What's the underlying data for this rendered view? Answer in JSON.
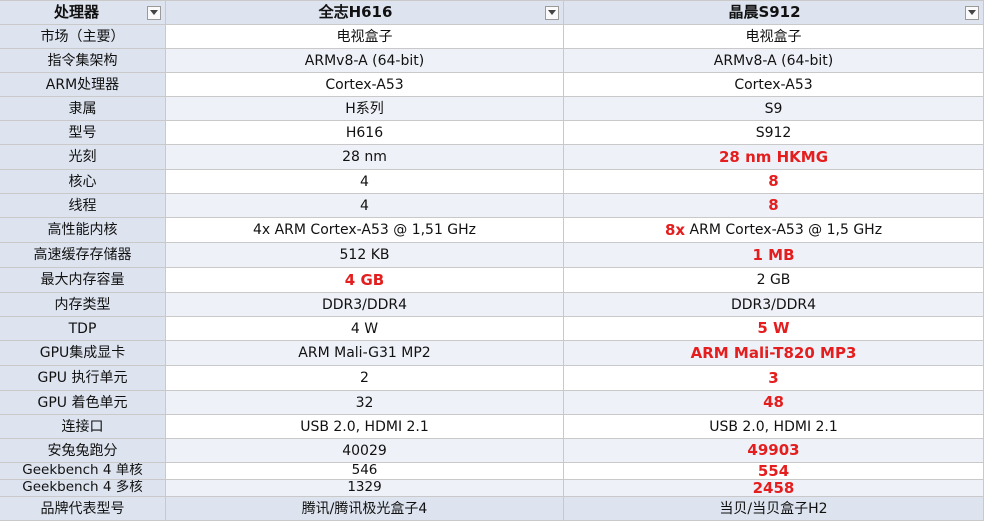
{
  "table": {
    "headers": [
      "处理器",
      "全志H616",
      "晶晨S912"
    ],
    "rows": [
      {
        "label": "市场（主要）",
        "a": "电视盒子",
        "b": "电视盒子"
      },
      {
        "label": "指令集架构",
        "a": "ARMv8-A (64-bit)",
        "b": "ARMv8-A (64-bit)"
      },
      {
        "label": "ARM处理器",
        "a": "Cortex-A53",
        "b": "Cortex-A53"
      },
      {
        "label": "隶属",
        "a": "H系列",
        "b": "S9"
      },
      {
        "label": "型号",
        "a": "H616",
        "b": "S912"
      },
      {
        "label": "光刻",
        "a": "28 nm",
        "b": "28 nm HKMG",
        "win": "b"
      },
      {
        "label": "核心",
        "a": "4",
        "b": "8",
        "win": "b"
      },
      {
        "label": "线程",
        "a": "4",
        "b": "8",
        "win": "b"
      },
      {
        "label": "高性能内核",
        "a": "4x ARM Cortex-A53 @ 1,51 GHz",
        "b_bold": "8x",
        "b_rest": " ARM Cortex-A53 @ 1,5 GHz"
      },
      {
        "label": "高速缓存存储器",
        "a": "512 KB",
        "b": "1 MB",
        "win": "b"
      },
      {
        "label": "最大内存容量",
        "a": "4 GB",
        "b": "2 GB",
        "win": "a"
      },
      {
        "label": "内存类型",
        "a": "DDR3/DDR4",
        "b": "DDR3/DDR4"
      },
      {
        "label": "TDP",
        "a": "4 W",
        "b": "5 W",
        "win": "b"
      },
      {
        "label": "GPU集成显卡",
        "a": "ARM Mali-G31 MP2",
        "b": "ARM Mali-T820 MP3",
        "win": "b"
      },
      {
        "label": "GPU 执行单元",
        "a": "2",
        "b": "3",
        "win": "b"
      },
      {
        "label": "GPU 着色单元",
        "a": "32",
        "b": "48",
        "win": "b"
      },
      {
        "label": "连接口",
        "a": "USB 2.0, HDMI 2.1",
        "b": "USB 2.0, HDMI 2.1"
      },
      {
        "label": "安兔兔跑分",
        "a": "40029",
        "b": "49903",
        "win": "b"
      },
      {
        "label": "Geekbench 4 单核",
        "a": "546",
        "b": "554",
        "win": "b"
      },
      {
        "label": "Geekbench 4 多核",
        "a": "1329",
        "b": "2458",
        "win": "b"
      },
      {
        "label": "品牌代表型号",
        "a": "腾讯/腾讯极光盒子4",
        "b": "当贝/当贝盒子H2"
      }
    ]
  },
  "colors": {
    "header_bg": "#dde4ef",
    "winner_text": "#e41e1e",
    "grid": "#c9c9c9"
  },
  "icons": {
    "filter_dropdown": "chevron-down-icon"
  }
}
